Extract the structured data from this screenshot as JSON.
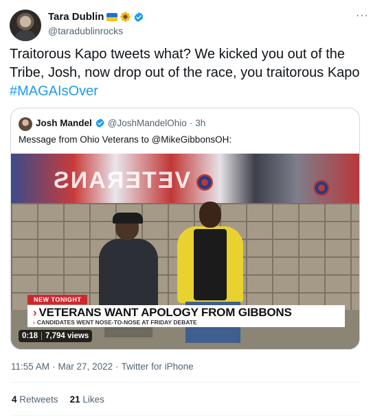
{
  "author": {
    "display_name": "Tara Dublin",
    "handle": "@taradublinrocks",
    "name_emoji": [
      "ukraine-flag-icon",
      "sunflower-icon"
    ],
    "verified": true
  },
  "more_label": "···",
  "tweet": {
    "text": "Traitorous Kapo tweets what? We kicked you out of the Tribe, Josh, now drop out of the race, you traitorous Kapo ",
    "hashtag": "#MAGAIsOver"
  },
  "quote": {
    "display_name": "Josh Mandel",
    "handle": "@JoshMandelOhio",
    "separator": "·",
    "time": "3h",
    "text": "Message from Ohio Veterans to @MikeGibbonsOH:",
    "video": {
      "news_tag": "NEW TONIGHT",
      "headline": "VETERANS WANT APOLOGY FROM GIBBONS",
      "subline": "CANDIDATES WENT NOSE-TO-NOSE AT FRIDAY DEBATE",
      "duration": "0:18",
      "views": "7,794 views"
    }
  },
  "meta": {
    "time": "11:55 AM",
    "separator": "·",
    "date": "Mar 27, 2022",
    "source": "Twitter for iPhone"
  },
  "stats": {
    "retweets_count": "4",
    "retweets_label": "Retweets",
    "likes_count": "21",
    "likes_label": "Likes"
  },
  "colors": {
    "link": "#1d9bf0",
    "verified": "#1d9bf0",
    "muted": "#536471",
    "news_red": "#d2262d"
  }
}
